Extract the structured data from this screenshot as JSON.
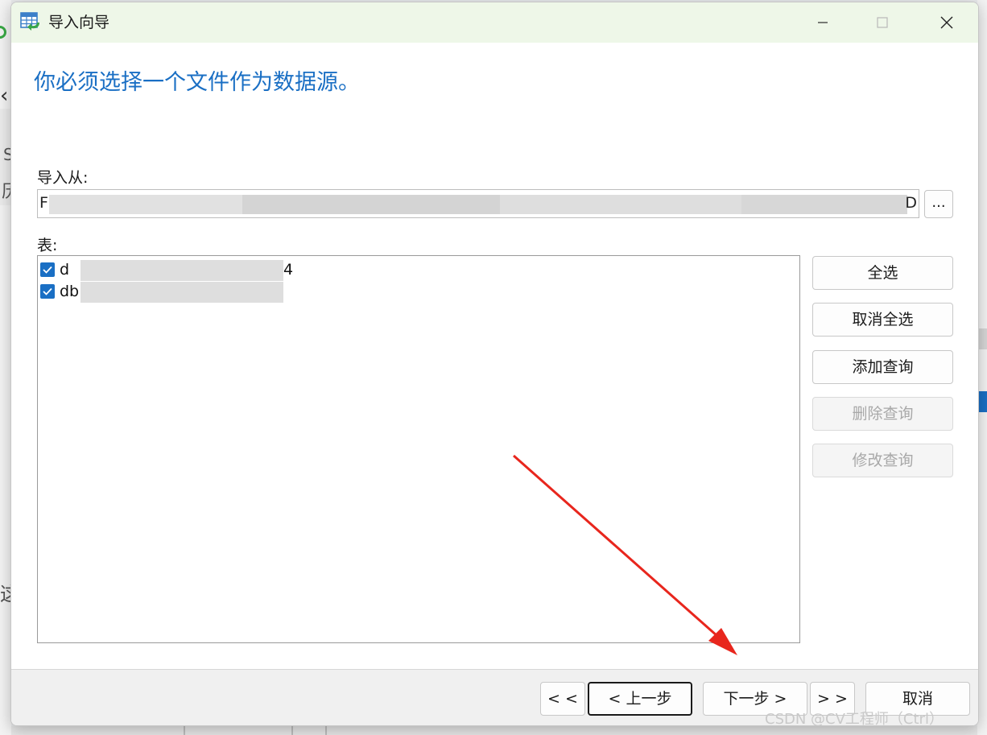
{
  "window": {
    "title": "导入向导",
    "icon": "table-import-icon",
    "controls": [
      "minimize",
      "maximize-disabled",
      "close"
    ]
  },
  "heading": "你必须选择一个文件作为数据源。",
  "import_from": {
    "label": "导入从:",
    "value_start": "F",
    "value_end": "D",
    "browse_label": "..."
  },
  "tables": {
    "label": "表:",
    "items": [
      {
        "name": "d",
        "tail": "4",
        "checked": true
      },
      {
        "name": "db",
        "tail": "",
        "checked": true
      }
    ]
  },
  "side_buttons": {
    "select_all": "全选",
    "deselect_all": "取消全选",
    "add_query": "添加查询",
    "delete_query": "删除查询",
    "modify_query": "修改查询"
  },
  "footer": {
    "first": "< <",
    "back": "< 上一步",
    "next": "下一步 >",
    "last": "> >",
    "cancel": "取消"
  },
  "watermark": "CSDN @CV工程师（Ctrl）",
  "colors": {
    "accent": "#1a6fc4",
    "titlebar": "#eef7e8",
    "annotation_arrow": "#e8261d"
  }
}
